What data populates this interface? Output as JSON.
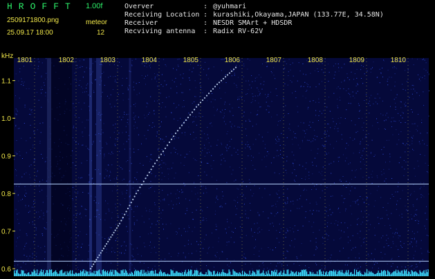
{
  "header": {
    "logo": "HROFFT",
    "version": "1.00f",
    "filename": "2509171800.png",
    "mode": "meteor",
    "datetime": "25.09.17 18:00",
    "count": "12",
    "rows": [
      {
        "key": "Overver",
        "value": "@yuhmari"
      },
      {
        "key": "Receiving Location",
        "value": "kurashiki,Okayama,JAPAN (133.77E, 34.58N)"
      },
      {
        "key": "Receiver",
        "value": "NESDR SMArt + HDSDR"
      },
      {
        "key": "Recviving antenna",
        "value": "Radix RV-62V"
      }
    ]
  },
  "chart_data": {
    "type": "spectrogram",
    "ylabel": "kHz",
    "y_ticks": [
      "1.1",
      "1.0",
      "0.9",
      "0.8",
      "0.7",
      "0.6"
    ],
    "y_tick_values": [
      1.1,
      1.0,
      0.9,
      0.8,
      0.7,
      0.6
    ],
    "ylim": [
      0.58,
      1.16
    ],
    "x_ticks": [
      "1801",
      "1802",
      "1803",
      "1804",
      "1805",
      "1806",
      "1807",
      "1808",
      "1809",
      "1810"
    ],
    "x_tick_values": [
      1801,
      1802,
      1803,
      1804,
      1805,
      1806,
      1807,
      1808,
      1809,
      1810
    ],
    "xlim": [
      1800.5,
      1810.5
    ],
    "horizontal_lines_khz": [
      0.825,
      0.62
    ],
    "meteor_trace": [
      {
        "t": 1802.35,
        "f": 0.6
      },
      {
        "t": 1802.7,
        "f": 0.66
      },
      {
        "t": 1803.05,
        "f": 0.72
      },
      {
        "t": 1803.45,
        "f": 0.8
      },
      {
        "t": 1803.9,
        "f": 0.88
      },
      {
        "t": 1804.4,
        "f": 0.96
      },
      {
        "t": 1804.9,
        "f": 1.03
      },
      {
        "t": 1805.4,
        "f": 1.09
      },
      {
        "t": 1805.9,
        "f": 1.14
      }
    ],
    "colors": {
      "background": "#05093a",
      "noise": "#3a5cff",
      "trace": "#cfe4ff",
      "line": "#b8d4ff",
      "tick": "#f2e84a",
      "baseline": "#3ee0ff"
    }
  }
}
